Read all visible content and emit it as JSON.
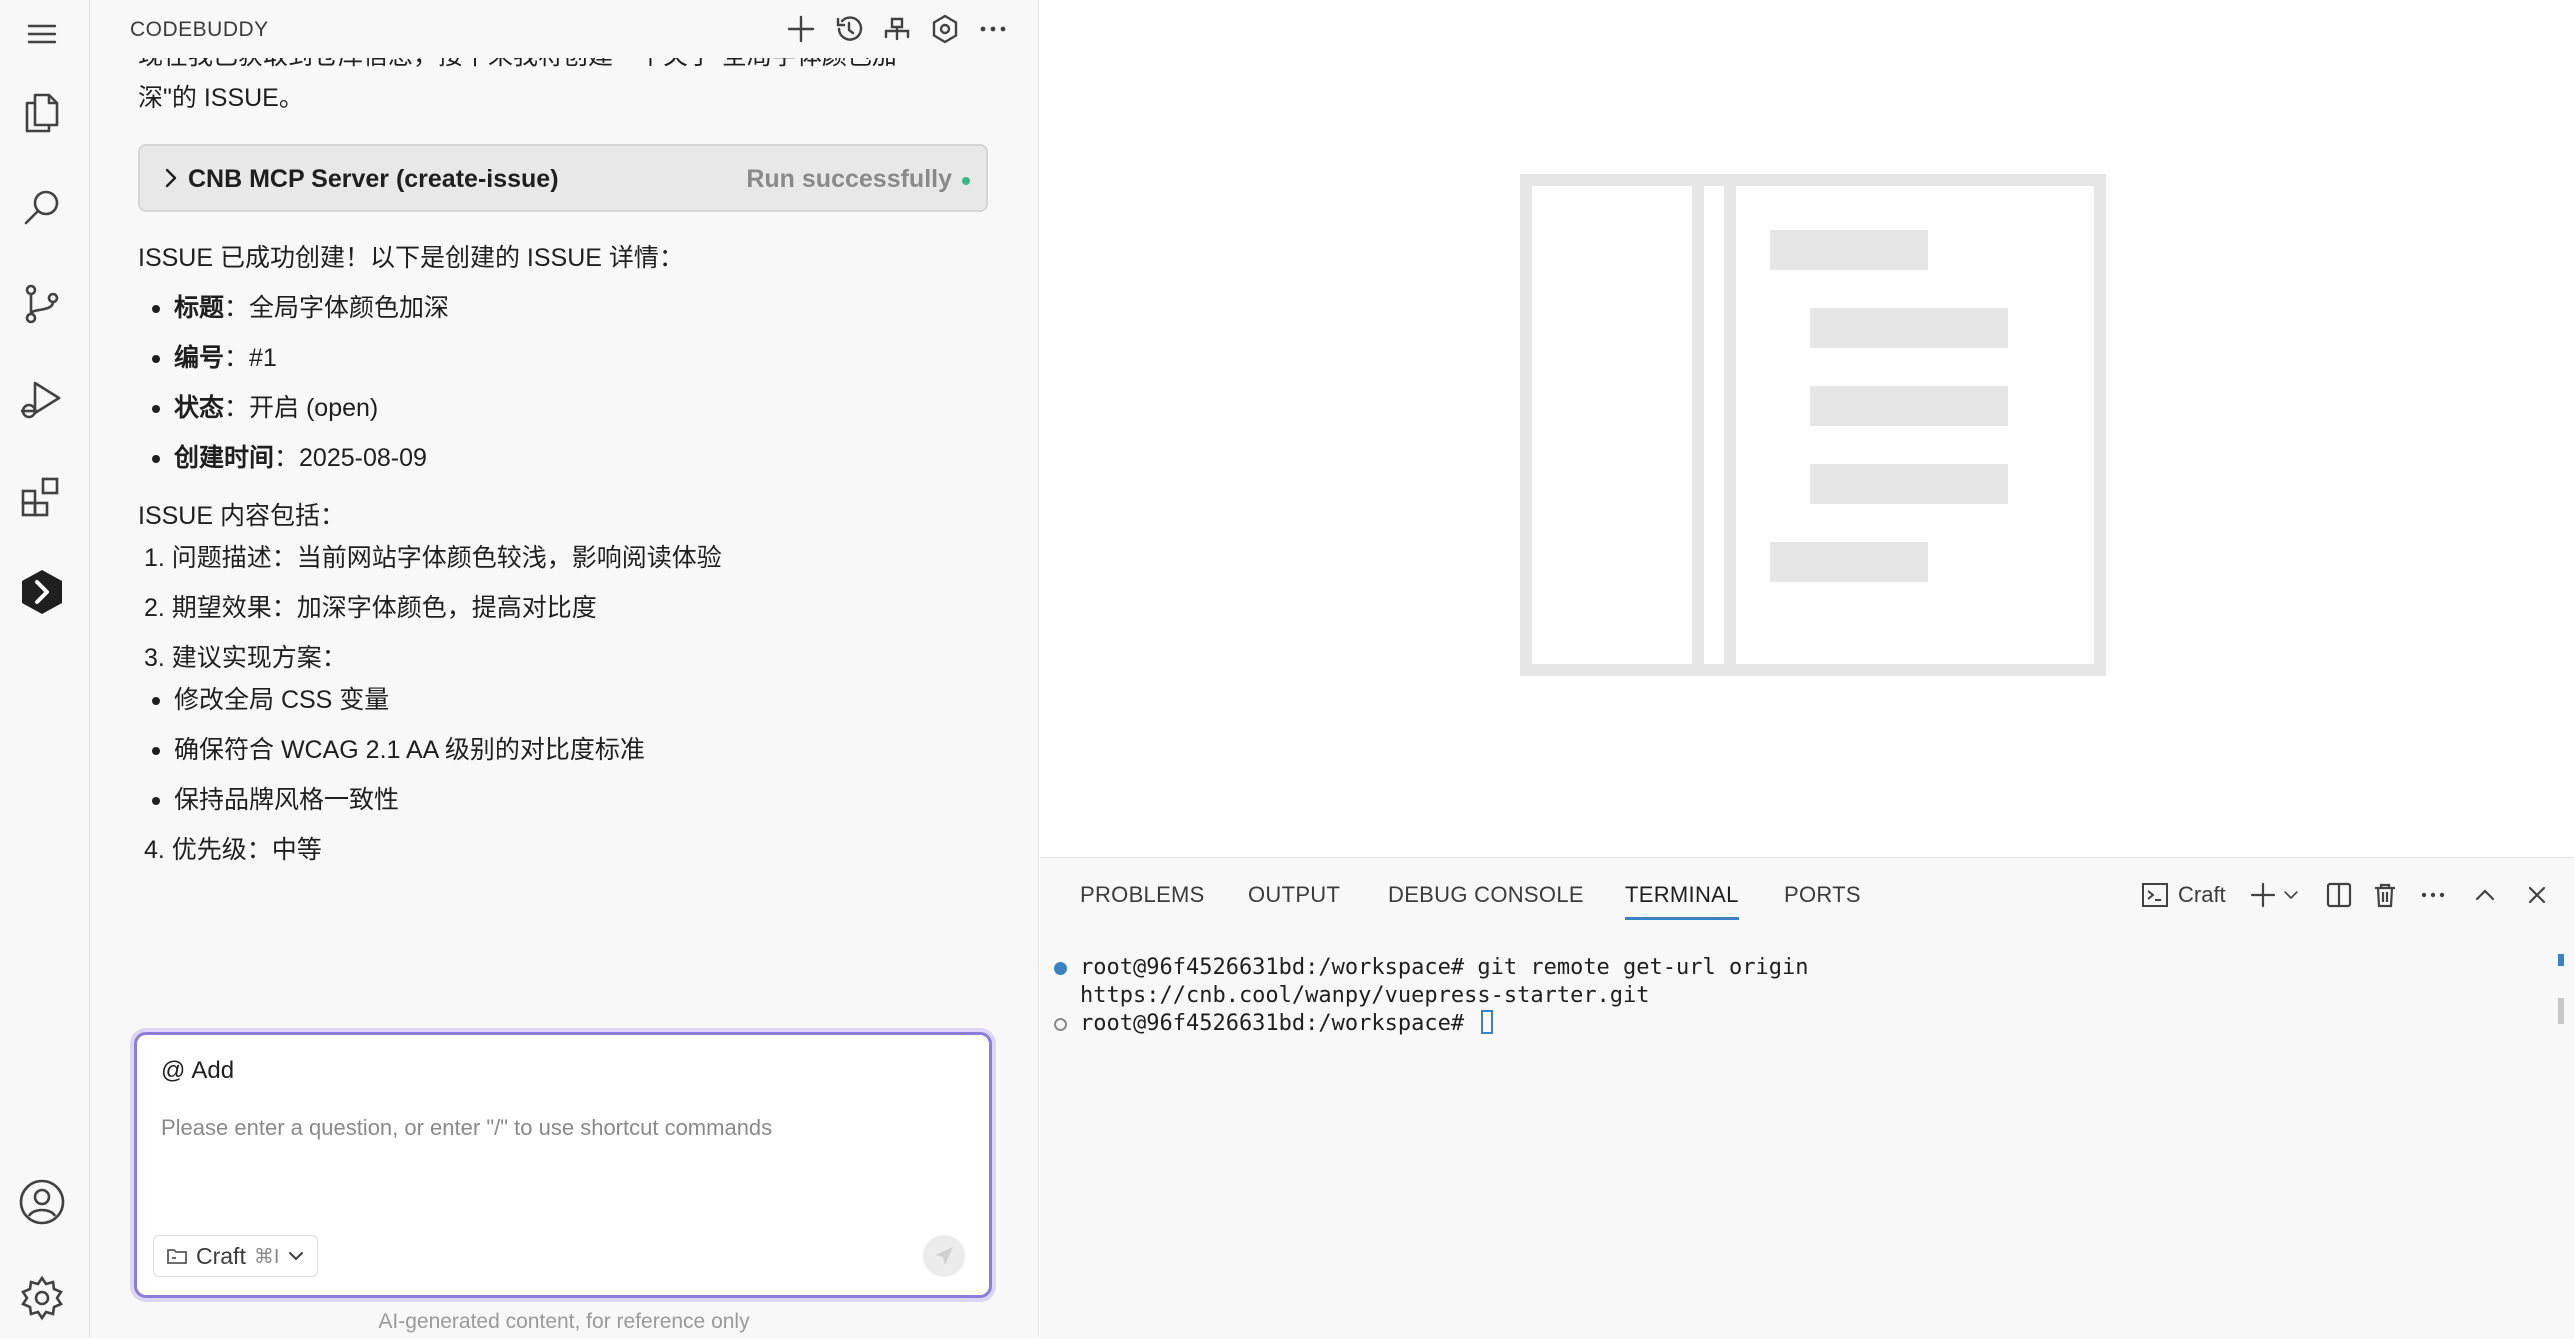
{
  "activity_bar": {
    "items": [
      {
        "icon": "menu-icon"
      },
      {
        "icon": "files-icon"
      },
      {
        "icon": "search-icon"
      },
      {
        "icon": "source-control-icon"
      },
      {
        "icon": "run-debug-icon"
      },
      {
        "icon": "extensions-icon"
      },
      {
        "icon": "codebuddy-icon"
      }
    ],
    "bottom": [
      {
        "icon": "account-icon"
      },
      {
        "icon": "settings-gear-icon"
      }
    ]
  },
  "panel": {
    "title": "CODEBUDDY",
    "header_icons": [
      "add-icon",
      "history-icon",
      "mcp-icon",
      "settings-icon",
      "more-icon"
    ]
  },
  "chat": {
    "partial_line_1": "现在我已获取到仓库信息，接下来我将创建一个关于\"全局字体颜色加",
    "partial_line_2": "深\"的 ISSUE。",
    "tool_call": {
      "name": "CNB MCP Server (create-issue)",
      "status": "Run successfully"
    },
    "success_text": "ISSUE 已成功创建！以下是创建的 ISSUE 详情：",
    "details": [
      {
        "label": "标题",
        "sep": "：",
        "value": "全局字体颜色加深"
      },
      {
        "label": "编号",
        "sep": "：",
        "value": "#1"
      },
      {
        "label": "状态",
        "sep": "：",
        "value": "开启 (open)"
      },
      {
        "label": "创建时间",
        "sep": "：",
        "value": "2025-08-09"
      }
    ],
    "content_intro": "ISSUE 内容包括：",
    "content_items": [
      "1. 问题描述：当前网站字体颜色较浅，影响阅读体验",
      "2. 期望效果：加深字体颜色，提高对比度",
      "3. 建议实现方案："
    ],
    "sub_items": [
      "修改全局 CSS 变量",
      "确保符合 WCAG 2.1 AA 级别的对比度标准",
      "保持品牌风格一致性"
    ],
    "priority": "4. 优先级：中等"
  },
  "input": {
    "add_label": "Add",
    "placeholder": "Please enter a question, or enter \"/\" to use shortcut commands",
    "mode": "Craft",
    "shortcut": "⌘I"
  },
  "disclaimer": "AI-generated content, for reference only",
  "bottom_panel": {
    "tabs": [
      "PROBLEMS",
      "OUTPUT",
      "DEBUG CONSOLE",
      "TERMINAL",
      "PORTS"
    ],
    "active_tab": "TERMINAL",
    "terminal_profile": "Craft",
    "terminal_lines": [
      "root@96f4526631bd:/workspace# git remote get-url origin",
      "https://cnb.cool/wanpy/vuepress-starter.git",
      "root@96f4526631bd:/workspace# "
    ]
  },
  "colors": {
    "accent": "#3b82c4",
    "input_border": "#8a7fd8",
    "success_dot": "#3bb58a",
    "watermark": "#e6e6e6"
  }
}
